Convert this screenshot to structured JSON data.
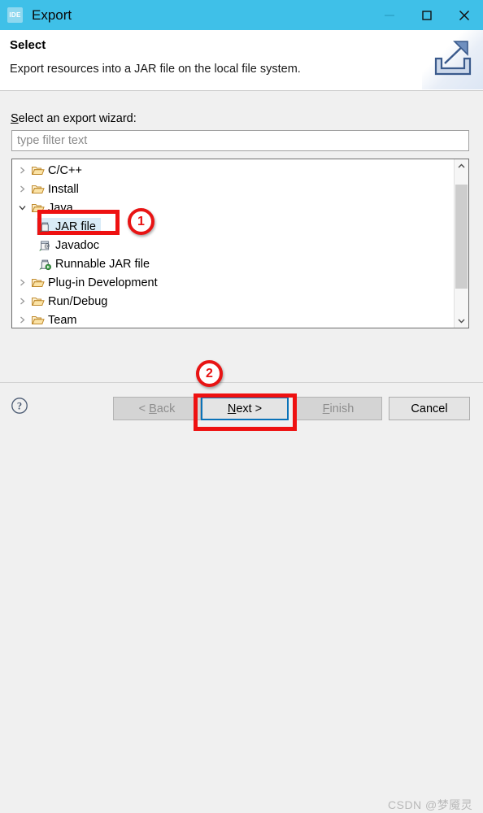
{
  "window": {
    "title": "Export",
    "icon_label": "IDE",
    "icon_name": "ide-app-icon",
    "titlebar_color": "#3fc0e8",
    "controls": [
      {
        "name": "minimize-button",
        "glyph": "minimize"
      },
      {
        "name": "maximize-button",
        "glyph": "maximize"
      },
      {
        "name": "close-button",
        "glyph": "close"
      }
    ]
  },
  "header": {
    "title": "Select",
    "description": "Export resources into a JAR file on the local file system.",
    "banner_icon": "export-arrow-icon"
  },
  "main": {
    "field_label_prefix": "S",
    "field_label_rest": "elect an export wizard:",
    "filter": {
      "value": "",
      "placeholder": "type filter text"
    },
    "tree": [
      {
        "label": "C/C++",
        "icon": "folder-icon",
        "expander": "collapsed",
        "level": 0,
        "selected": false
      },
      {
        "label": "Install",
        "icon": "folder-icon",
        "expander": "collapsed",
        "level": 0,
        "selected": false
      },
      {
        "label": "Java",
        "icon": "folder-icon",
        "expander": "expanded",
        "level": 0,
        "selected": false
      },
      {
        "label": "JAR file",
        "icon": "jar-file-icon",
        "expander": "none",
        "level": 1,
        "selected": true
      },
      {
        "label": "Javadoc",
        "icon": "javadoc-icon",
        "expander": "none",
        "level": 1,
        "selected": false
      },
      {
        "label": "Runnable JAR file",
        "icon": "runnable-jar-icon",
        "expander": "none",
        "level": 1,
        "selected": false
      },
      {
        "label": "Plug-in Development",
        "icon": "folder-icon",
        "expander": "collapsed",
        "level": 0,
        "selected": false
      },
      {
        "label": "Run/Debug",
        "icon": "folder-icon",
        "expander": "collapsed",
        "level": 0,
        "selected": false
      },
      {
        "label": "Team",
        "icon": "folder-icon",
        "expander": "collapsed",
        "level": 0,
        "selected": false
      }
    ],
    "scrollbar": {
      "up_arrow": "chevron-up-icon",
      "down_arrow": "chevron-down-icon"
    }
  },
  "footer": {
    "help_icon": "help-question-icon",
    "buttons": [
      {
        "name": "back-button",
        "mnemonic_pre": "< ",
        "mnemonic": "B",
        "mnemonic_post": "ack",
        "enabled": false,
        "focused": false
      },
      {
        "name": "next-button",
        "mnemonic_pre": "",
        "mnemonic": "N",
        "mnemonic_post": "ext >",
        "enabled": true,
        "focused": true
      },
      {
        "name": "finish-button",
        "mnemonic_pre": "",
        "mnemonic": "F",
        "mnemonic_post": "inish",
        "enabled": false,
        "focused": false
      },
      {
        "name": "cancel-button",
        "mnemonic_pre": "",
        "mnemonic": "",
        "mnemonic_post": "Cancel",
        "enabled": true,
        "focused": false
      }
    ]
  },
  "annotations": {
    "badge_one": "1",
    "badge_two": "2",
    "color": "#ee1111"
  },
  "watermark": {
    "text": "CSDN @梦魇灵"
  }
}
